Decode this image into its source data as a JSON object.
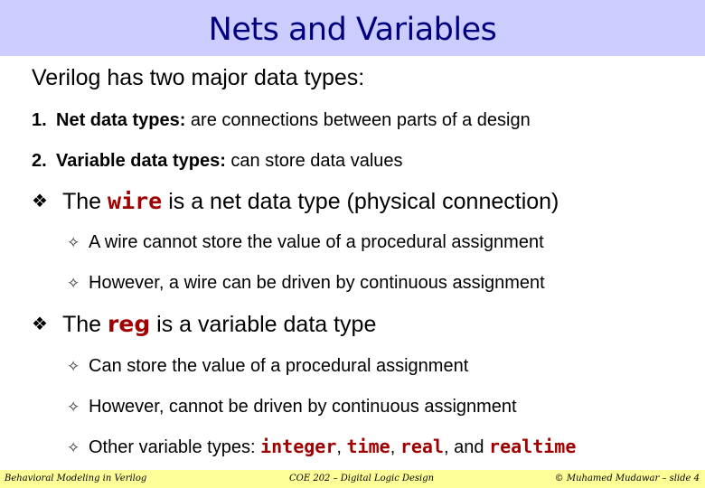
{
  "slide": {
    "title": "Nets and Variables",
    "intro": "Verilog has two major data types:",
    "numbered": [
      {
        "num": "1.",
        "term": "Net data types:",
        "text": " are connections between parts of a design"
      },
      {
        "num": "2.",
        "term": "Variable data types:",
        "text": " can store data values"
      }
    ],
    "bullets": [
      {
        "icon": "❖",
        "prefix": "The ",
        "code": "wire",
        "suffix": " is a net data type (physical connection)",
        "subs": [
          {
            "icon": "✧",
            "text": "A wire cannot store the value of a procedural assignment"
          },
          {
            "icon": "✧",
            "text": "However, a wire can be driven by continuous assignment"
          }
        ]
      },
      {
        "icon": "❖",
        "prefix": "The ",
        "code": "reg",
        "suffix": " is a variable data type",
        "subs": [
          {
            "icon": "✧",
            "text": "Can store the value of a procedural assignment"
          },
          {
            "icon": "✧",
            "text": "However, cannot be driven by continuous assignment"
          },
          {
            "icon": "✧",
            "text": "Other variable types: ",
            "codes": [
              "integer",
              "time",
              "real",
              "realtime"
            ],
            "sep1": ", ",
            "sep2": ", ",
            "sep3": ", and "
          }
        ]
      }
    ]
  },
  "footer": {
    "left": "Behavioral Modeling in Verilog",
    "center": "COE 202 – Digital Logic Design",
    "right": "© Muhamed Mudawar – slide 4"
  },
  "colors": {
    "title_bg": "#ccccff",
    "title_text": "#00007f",
    "code": "#a00000",
    "footer_bg": "#ffff99"
  }
}
